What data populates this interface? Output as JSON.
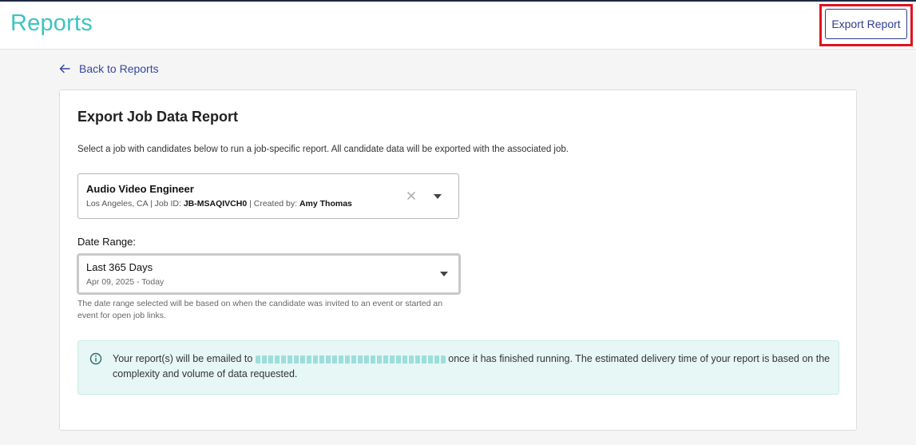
{
  "header": {
    "title": "Reports",
    "export_button": "Export Report"
  },
  "nav": {
    "back_label": "Back to Reports"
  },
  "card": {
    "title": "Export Job Data Report",
    "description": "Select a job with candidates below to run a job-specific report. All candidate data will be exported with the associated job."
  },
  "job_select": {
    "title": "Audio Video Engineer",
    "location": "Los Angeles, CA",
    "job_id_label": "Job ID:",
    "job_id": "JB-MSAQIVCH0",
    "created_by_label": "Created by:",
    "created_by": "Amy Thomas",
    "separator": "|"
  },
  "date_range": {
    "label": "Date Range:",
    "value": "Last 365 Days",
    "sub": "Apr 09, 2025 - Today",
    "note": "The date range selected will be based on when the candidate was invited to an event or started an event for open job links."
  },
  "info": {
    "text_before": "Your report(s) will be emailed to",
    "text_after": "once it has finished running. The estimated delivery time of your report is based on the complexity and volume of data requested."
  },
  "colors": {
    "brand_teal": "#3cc4c0",
    "link_blue": "#3548a0",
    "highlight_red": "#e0121f",
    "info_bg": "#e6f7f6"
  },
  "icons": {
    "back": "arrow-left-icon",
    "clear": "close-icon",
    "dropdown": "caret-down-icon",
    "info": "info-icon"
  }
}
